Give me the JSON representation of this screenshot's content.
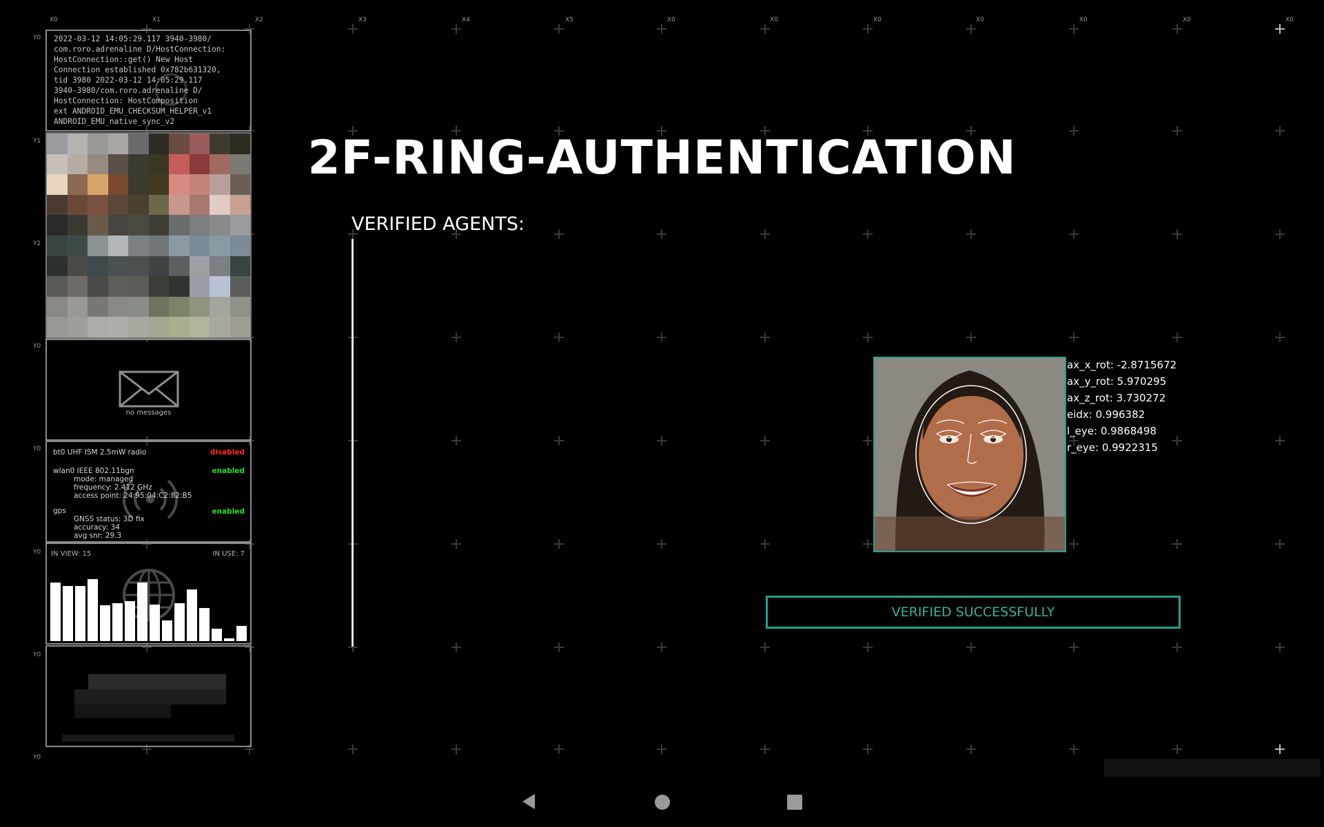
{
  "grid": {
    "column_labels": [
      "X0",
      "X1",
      "X2",
      "X3",
      "X4",
      "X5",
      "X0",
      "X0",
      "X0",
      "X0",
      "X0",
      "X0",
      "X0"
    ],
    "row_labels": [
      "Y0",
      "Y1",
      "Y2",
      "Y0",
      "Y0",
      "Y0",
      "Y0",
      "Y0"
    ]
  },
  "side_panels": {
    "log": {
      "text": "2022-03-12 14:05:29.117 3940-3980/\ncom.roro.adrenaline D/HostConnection:\nHostConnection::get() New Host\nConnection established 0x782b631320,\ntid 3980 2022-03-12 14:05:29.117\n3940-3980/com.roro.adrenaline D/\nHostConnection: HostComposition\next ANDROID_EMU_CHECKSUM_HELPER_v1\nANDROID_EMU_native_sync_v2"
    },
    "camera": {
      "icon": "pixelated-camera-feed"
    },
    "messages": {
      "icon": "envelope-icon",
      "label": "no messages"
    },
    "network": {
      "bt_label": "bt0 UHF ISM 2.5mW radio",
      "bt_status": "disabled",
      "wlan_label": "wlan0 IEEE 802.11bgn",
      "wlan_status": "enabled",
      "wlan_mode": "mode: managed",
      "wlan_freq": "frequency: 2.412 GHz",
      "wlan_ap": "access point: 24:95:04:C2:82:B5",
      "gps_label": "gps",
      "gps_status": "enabled",
      "gnss_status": "GNSS status: 3D fix",
      "gnss_accuracy": "accuracy: 34",
      "gnss_snr": "avg snr: 29.3",
      "icon": "broadcast-icon"
    },
    "satellites": {
      "in_view_label": "IN VIEW: 15",
      "in_use_label": "IN USE: 7",
      "bar_levels": [
        0.85,
        0.8,
        0.8,
        0.9,
        0.52,
        0.55,
        0.58,
        0.85,
        0.53,
        0.3,
        0.55,
        0.75,
        0.48,
        0.18,
        0.04,
        0.22
      ],
      "icon": "globe-icon"
    },
    "redacted": {
      "icon": "redacted-block"
    }
  },
  "main": {
    "title": "2F-RING-AUTHENTICATION",
    "verified_agents_label": "VERIFIED AGENTS:",
    "face_metrics": [
      "ax_x_rot: -2.8715672",
      "ax_y_rot: 5.970295",
      "ax_z_rot: 3.730272",
      "eidx: 0.996382",
      "l_eye: 0.9868498",
      "r_eye: 0.9922315"
    ],
    "status_message": "VERIFIED SUCCESSFULLY",
    "accent_color": "#26a08e"
  },
  "navigation": {
    "back_icon": "back-triangle-icon",
    "home_icon": "home-circle-icon",
    "recents_icon": "recents-square-icon"
  }
}
